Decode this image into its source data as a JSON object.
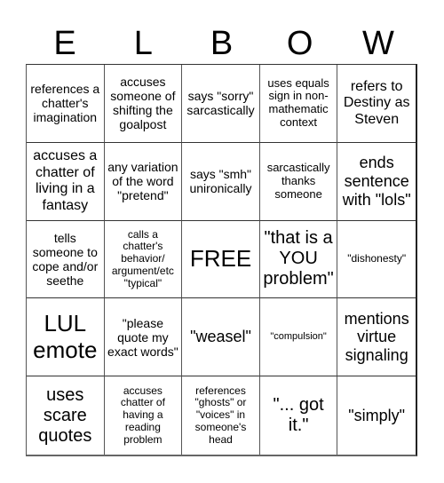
{
  "title_letters": [
    "E",
    "L",
    "B",
    "O",
    "W"
  ],
  "cells": [
    [
      "references a chatter's imagination",
      "accuses someone of shifting the goalpost",
      "says \"sorry\" sarcastically",
      "uses equals sign in non-mathematic context",
      "refers to Destiny as Steven"
    ],
    [
      "accuses a chatter of living in a fantasy",
      "any variation of the word \"pretend\"",
      "says \"smh\" unironically",
      "sarcastically thanks someone",
      "ends sentence with \"lols\""
    ],
    [
      "tells someone to cope and/or seethe",
      "calls a chatter's behavior/ argument/etc \"typical\"",
      "FREE",
      "\"that is a YOU problem\"",
      "\"dishonesty\""
    ],
    [
      "LUL emote",
      "\"please quote my exact words\"",
      "\"weasel\"",
      "\"compulsion\"",
      "mentions virtue signaling"
    ],
    [
      "uses scare quotes",
      "accuses chatter of having a reading problem",
      "references \"ghosts\" or \"voices\" in someone's head",
      "\"... got it.\"",
      "\"simply\""
    ]
  ]
}
